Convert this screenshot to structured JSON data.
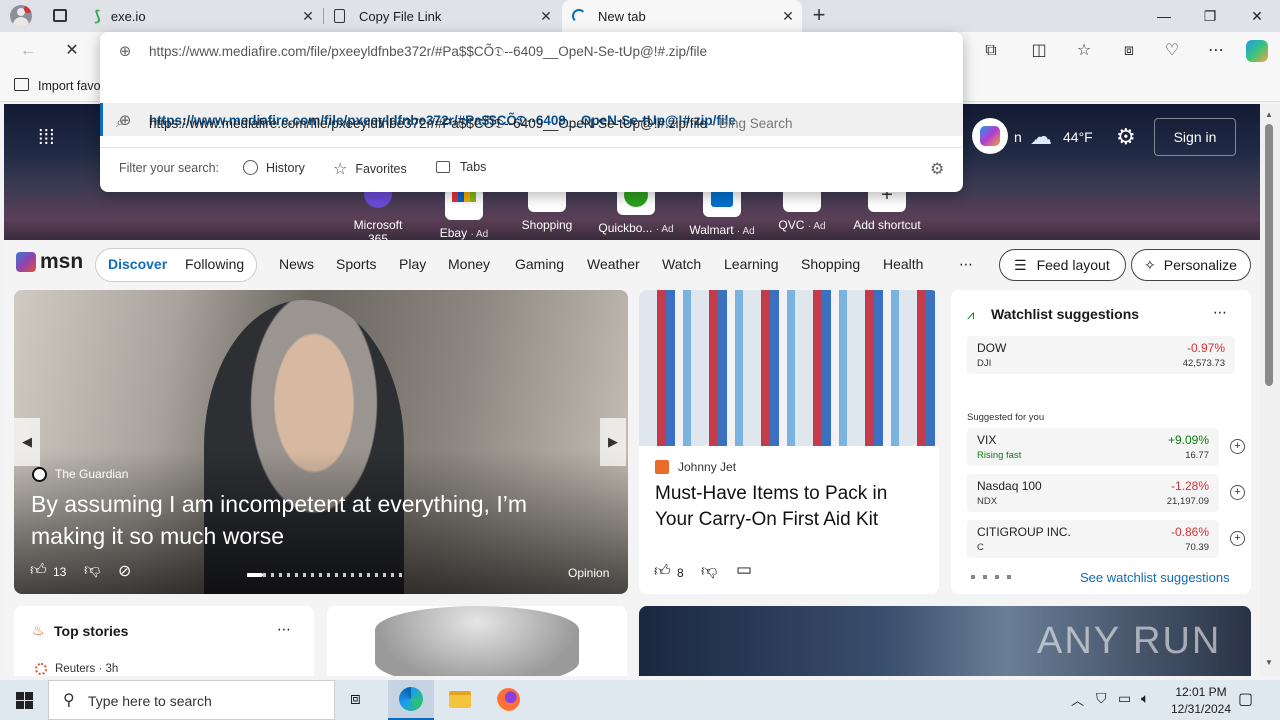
{
  "tabs": [
    {
      "title": "exe.io",
      "icon": "exeio-icon"
    },
    {
      "title": "Copy File Link",
      "icon": "document-icon"
    },
    {
      "title": "New tab",
      "icon": "loading-icon"
    }
  ],
  "toolbar": {
    "address_value": "https://www.mediafire.com/file/pxeeyldfnbe372r/#Pa$$CÕ𝔇--6409__OpeN-Se-tUp@!#.zip/file"
  },
  "favbar": {
    "import_label": "Import favo"
  },
  "omnibox": {
    "suggestion_url": "https://www.mediafire.com/file/pxeeyldfnbe372r/#Pa$$CÕ𝔇--6409__OpeN-Se-tUp@!#.zip/file",
    "suggestion_search": "https://www.mediafire.com/file/pxeeyldfnbe372r/#Pa$$CÕ𝔇--6409__OpeN-Se-tUp@!#.zip/file",
    "bing_suffix": " - Bing Search",
    "filter_label": "Filter your search:",
    "filters": [
      "History",
      "Favorites",
      "Tabs"
    ]
  },
  "hero": {
    "weather_temp": "44°F",
    "signin_label": "Sign in",
    "copilot_partial": "n",
    "shortcuts": [
      {
        "label": "Microsoft 365",
        "ad": ""
      },
      {
        "label": "Ebay",
        "ad": "· Ad"
      },
      {
        "label": "Shopping",
        "ad": ""
      },
      {
        "label": "Quickbo...",
        "ad": "· Ad"
      },
      {
        "label": "Walmart",
        "ad": "· Ad"
      },
      {
        "label": "QVC",
        "ad": "· Ad"
      },
      {
        "label": "Add shortcut",
        "ad": ""
      }
    ]
  },
  "msn": {
    "logo_text": "msn",
    "discover": "Discover",
    "following": "Following",
    "nav": [
      "News",
      "Sports",
      "Play",
      "Money",
      "Gaming",
      "Weather",
      "Watch",
      "Learning",
      "Shopping",
      "Health"
    ],
    "more": "⋯",
    "feed_layout": "Feed layout",
    "personalize": "Personalize"
  },
  "main_story": {
    "source": "The Guardian",
    "headline": "By assuming I am incompetent at everything, I’m making it so much worse",
    "likes": "13",
    "tag": "Opinion"
  },
  "side_story": {
    "source": "Johnny Jet",
    "headline": "Must-Have Items to Pack in Your Carry-On First Aid Kit",
    "likes": "8"
  },
  "watchlist": {
    "title": "Watchlist suggestions",
    "more": "⋯",
    "dow": {
      "name": "DOW",
      "symbol": "DJI",
      "pct": "-0.97%",
      "value": "42,573.73"
    },
    "suggested_label": "Suggested for you",
    "items": [
      {
        "name": "VIX",
        "symbol": "Rising fast",
        "pct": "+9.09%",
        "value": "16.77",
        "up": true
      },
      {
        "name": "Nasdaq 100",
        "symbol": "NDX",
        "pct": "-1.28%",
        "value": "21,197.09",
        "up": false
      },
      {
        "name": "CITIGROUP INC.",
        "symbol": "C",
        "pct": "-0.86%",
        "value": "70.39",
        "up": false
      }
    ],
    "see_link": "See watchlist suggestions"
  },
  "top_stories": {
    "title": "Top stories",
    "more": "⋯",
    "first_source": "Reuters · 3h"
  },
  "watermark": "ANY RUN",
  "taskbar": {
    "search_placeholder": "Type here to search",
    "time": "12:01 PM",
    "date": "12/31/2024"
  },
  "colors": {
    "accent": "#0f6cbd",
    "negative": "#d13438",
    "positive": "#107c10"
  }
}
